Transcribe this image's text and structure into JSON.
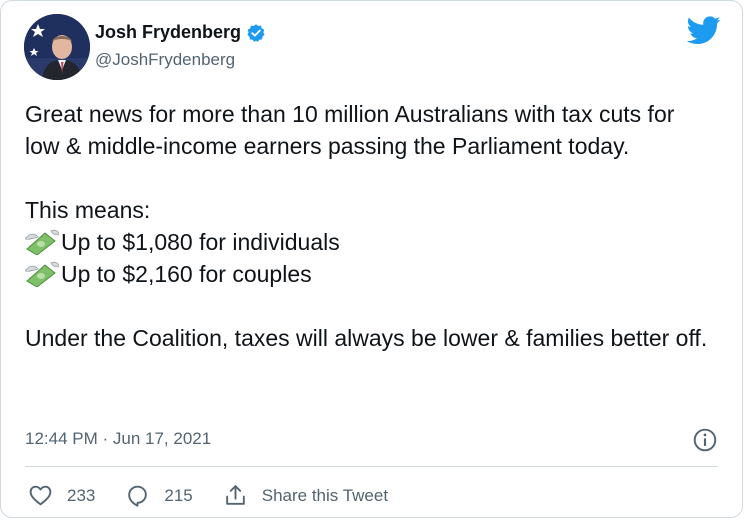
{
  "author": {
    "display_name": "Josh Frydenberg",
    "handle": "@JoshFrydenberg",
    "verified": true
  },
  "tweet": {
    "paragraph1": "Great news for more than 10 million Australians with tax cuts for low & middle-income earners passing the Parliament today.",
    "means_label": "This means:",
    "bullet1": "Up to $1,080 for individuals",
    "bullet2": "Up to $2,160 for couples",
    "paragraph3": "Under the Coalition, taxes will always be lower & families better off.",
    "bullet_icon": "money-with-wings-icon"
  },
  "meta": {
    "timestamp": "12:44 PM · Jun 17, 2021"
  },
  "actions": {
    "like_count": "233",
    "reply_count": "215",
    "share_label": "Share this Tweet"
  },
  "colors": {
    "brand_blue": "#1d9bf0",
    "secondary_text": "#536471",
    "primary_text": "#0f1419",
    "border": "#cfd9de"
  }
}
